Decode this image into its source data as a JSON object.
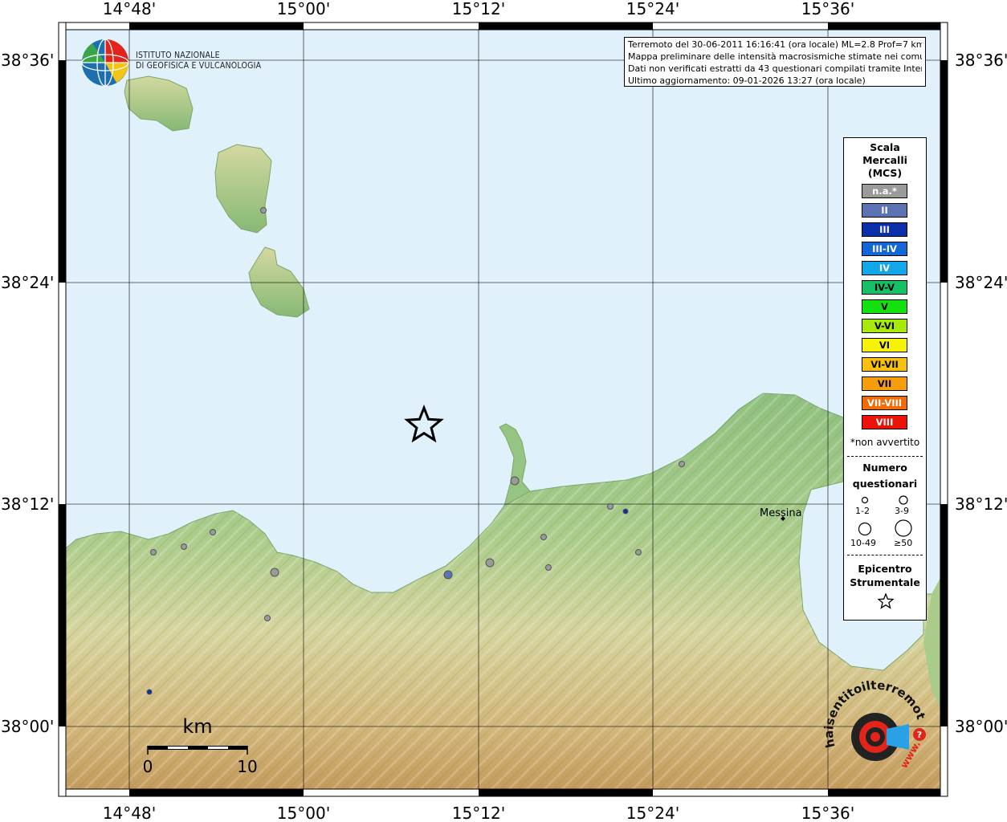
{
  "map": {
    "lon_labels": [
      "14°48'",
      "15°00'",
      "15°12'",
      "15°24'",
      "15°36'"
    ],
    "lat_labels": [
      "38°36'",
      "38°24'",
      "38°12'",
      "38°00'"
    ],
    "colors": {
      "sea": "#e1f1fc",
      "lowland": "#8fc07f",
      "hills": "#d9d7a3",
      "mountains": "#c9a76b",
      "frame": "#000000"
    }
  },
  "header": {
    "logo_line1": "ISTITUTO NAZIONALE",
    "logo_line2": "DI GEOFISICA E VULCANOLOGIA",
    "logo_icon": "ingv-globe-icon"
  },
  "info": {
    "line1": "Terremoto del 30-06-2011 16:16:41 (ora locale) ML=2.8 Prof=7 km",
    "line2": "Mappa preliminare delle intensità macrosismiche stimate nei comuni.",
    "line3": "Dati non verificati estratti da 43 questionari compilati tramite Internet.",
    "line4": "Ultimo aggiornamento: 09-01-2026 13:27 (ora locale)"
  },
  "legend": {
    "title_line1": "Scala",
    "title_line2": "Mercalli",
    "title_line3": "(MCS)",
    "scale": [
      {
        "label": "n.a.*",
        "color": "#9a9a9a"
      },
      {
        "label": "II",
        "color": "#5b73b3"
      },
      {
        "label": "III",
        "color": "#0b2fa8"
      },
      {
        "label": "III-IV",
        "color": "#1366d6"
      },
      {
        "label": "IV",
        "color": "#12a6ea"
      },
      {
        "label": "IV-V",
        "color": "#17c067"
      },
      {
        "label": "V",
        "color": "#12e10e"
      },
      {
        "label": "V-VI",
        "color": "#a8ea06"
      },
      {
        "label": "VI",
        "color": "#f7f206"
      },
      {
        "label": "VI-VII",
        "color": "#f8c10d"
      },
      {
        "label": "VII",
        "color": "#f59e09"
      },
      {
        "label": "VII-VIII",
        "color": "#f36b05"
      },
      {
        "label": "VIII",
        "color": "#ee1206"
      }
    ],
    "not_felt_note": "*non avvertito",
    "count_title1": "Numero",
    "count_title2": "questionari",
    "count_sizes": [
      "1-2",
      "3-9",
      "10-49",
      "≥50"
    ],
    "epi_title1": "Epicentro",
    "epi_title2": "Strumentale"
  },
  "places": {
    "city": "Messina"
  },
  "scalebar": {
    "unit": "km",
    "min_label": "0",
    "max_label": "10"
  },
  "watermark": {
    "text1": "haisentito",
    "text2": "ilterremoto.it",
    "text3": "www.",
    "icon": "seismograph-target-icon"
  },
  "observations": [
    {
      "name": "obs-milazzo",
      "intensity": "n.a.*",
      "size": "3-9"
    },
    {
      "name": "obs-east-1",
      "intensity": "n.a.*",
      "size": "1-2"
    },
    {
      "name": "obs-east-2",
      "intensity": "n.a.*",
      "size": "1-2"
    },
    {
      "name": "obs-east-3",
      "intensity": "III",
      "size": "1-2"
    },
    {
      "name": "obs-mid-1",
      "intensity": "n.a.*",
      "size": "1-2"
    },
    {
      "name": "obs-mid-2",
      "intensity": "n.a.*",
      "size": "3-9"
    },
    {
      "name": "obs-mid-3",
      "intensity": "n.a.*",
      "size": "1-2"
    },
    {
      "name": "obs-mid-4",
      "intensity": "II",
      "size": "3-9"
    },
    {
      "name": "obs-mid-5",
      "intensity": "n.a.*",
      "size": "1-2"
    },
    {
      "name": "obs-west-1",
      "intensity": "n.a.*",
      "size": "1-2"
    },
    {
      "name": "obs-west-2",
      "intensity": "n.a.*",
      "size": "1-2"
    },
    {
      "name": "obs-west-3",
      "intensity": "n.a.*",
      "size": "1-2"
    },
    {
      "name": "obs-west-4",
      "intensity": "n.a.*",
      "size": "3-9"
    },
    {
      "name": "obs-west-5",
      "intensity": "n.a.*",
      "size": "1-2"
    },
    {
      "name": "obs-inland",
      "intensity": "III",
      "size": "1-2"
    }
  ]
}
